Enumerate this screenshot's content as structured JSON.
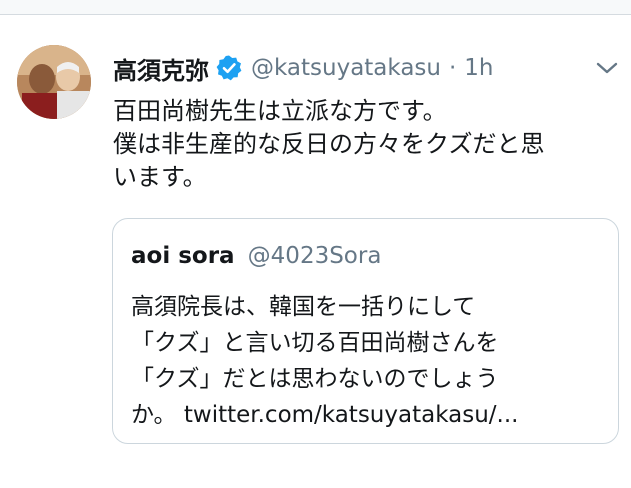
{
  "tweet": {
    "author_name": "高須克弥",
    "handle": "@katsuyatakasu",
    "separator": "·",
    "time": "1h",
    "lines": [
      "百田尚樹先生は立派な方です。",
      "僕は非生産的な反日の方々をクズだと思",
      "います。"
    ]
  },
  "quoted": {
    "author_name": "aoi sora",
    "handle": "@4023Sora",
    "lines": [
      "高須院長は、韓国を一括りにして",
      "「クズ」と言い切る百田尚樹さんを",
      "「クズ」だとは思わないのでしょう"
    ],
    "last_line_prefix": "か。",
    "link_text": "twitter.com/katsuyatakasu/..."
  },
  "icons": {
    "verified": "verified-badge-icon",
    "menu": "chevron-down-icon"
  },
  "colors": {
    "verified": "#1da1f2",
    "secondary_text": "#657786",
    "border": "#ccd6dd"
  }
}
